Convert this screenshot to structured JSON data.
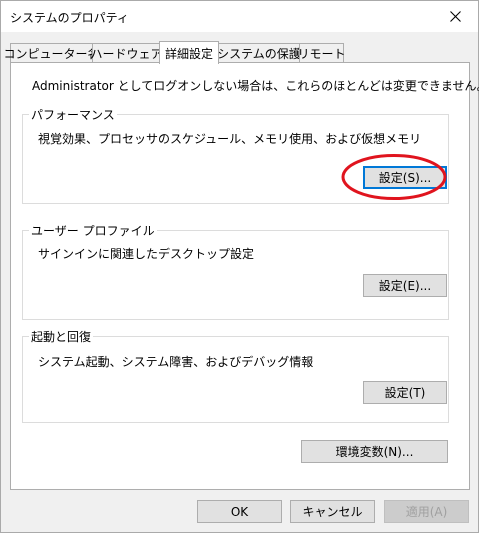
{
  "window": {
    "title": "システムのプロパティ"
  },
  "tabs": [
    {
      "label": "コンピューター名"
    },
    {
      "label": "ハードウェア"
    },
    {
      "label": "詳細設定"
    },
    {
      "label": "システムの保護"
    },
    {
      "label": "リモート"
    }
  ],
  "admin_note": "Administrator としてログオンしない場合は、これらのほとんどは変更できません。",
  "performance": {
    "title": "パフォーマンス",
    "description": "視覚効果、プロセッサのスケジュール、メモリ使用、および仮想メモリ",
    "button": "設定(S)..."
  },
  "user_profile": {
    "title": "ユーザー プロファイル",
    "description": "サインインに関連したデスクトップ設定",
    "button": "設定(E)..."
  },
  "startup_recovery": {
    "title": "起動と回復",
    "description": "システム起動、システム障害、およびデバッグ情報",
    "button": "設定(T)"
  },
  "env_button": "環境変数(N)...",
  "footer": {
    "ok": "OK",
    "cancel": "キャンセル",
    "apply": "適用(A)"
  },
  "colors": {
    "highlight_ellipse": "#e0141e",
    "focus_border": "#0078d7"
  }
}
